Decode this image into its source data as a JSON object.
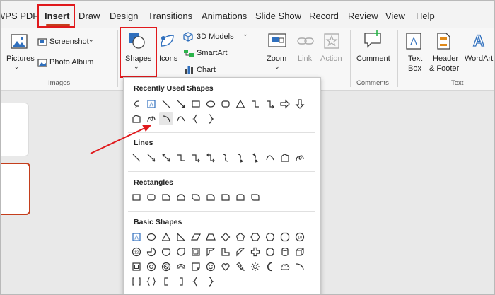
{
  "menu": {
    "items": [
      "WPS PDF",
      "Insert",
      "Draw",
      "Design",
      "Transitions",
      "Animations",
      "Slide Show",
      "Record",
      "Review",
      "View",
      "Help"
    ]
  },
  "ribbon": {
    "pictures": "Pictures",
    "screenshot": "Screenshot",
    "photo_album": "Photo Album",
    "images_group": "Images",
    "shapes_line1": "Shapes",
    "icons": "Icons",
    "models": "3D Models",
    "smartart": "SmartArt",
    "chart": "Chart",
    "zoom": "Zoom",
    "link": "Link",
    "action": "Action",
    "comment": "Comment",
    "comments_group": "Comments",
    "textbox_line1": "Text",
    "textbox_line2": "Box",
    "header_line1": "Header",
    "header_line2": "& Footer",
    "wordart": "WordArt",
    "text_group": "Text"
  },
  "dropdown": {
    "recent": "Recently Used Shapes",
    "lines": "Lines",
    "rectangles": "Rectangles",
    "basic": "Basic Shapes"
  },
  "colors": {
    "highlight_red": "#e0191c",
    "accent": "#c43e1c",
    "icon_blue": "#2f6fbd"
  }
}
